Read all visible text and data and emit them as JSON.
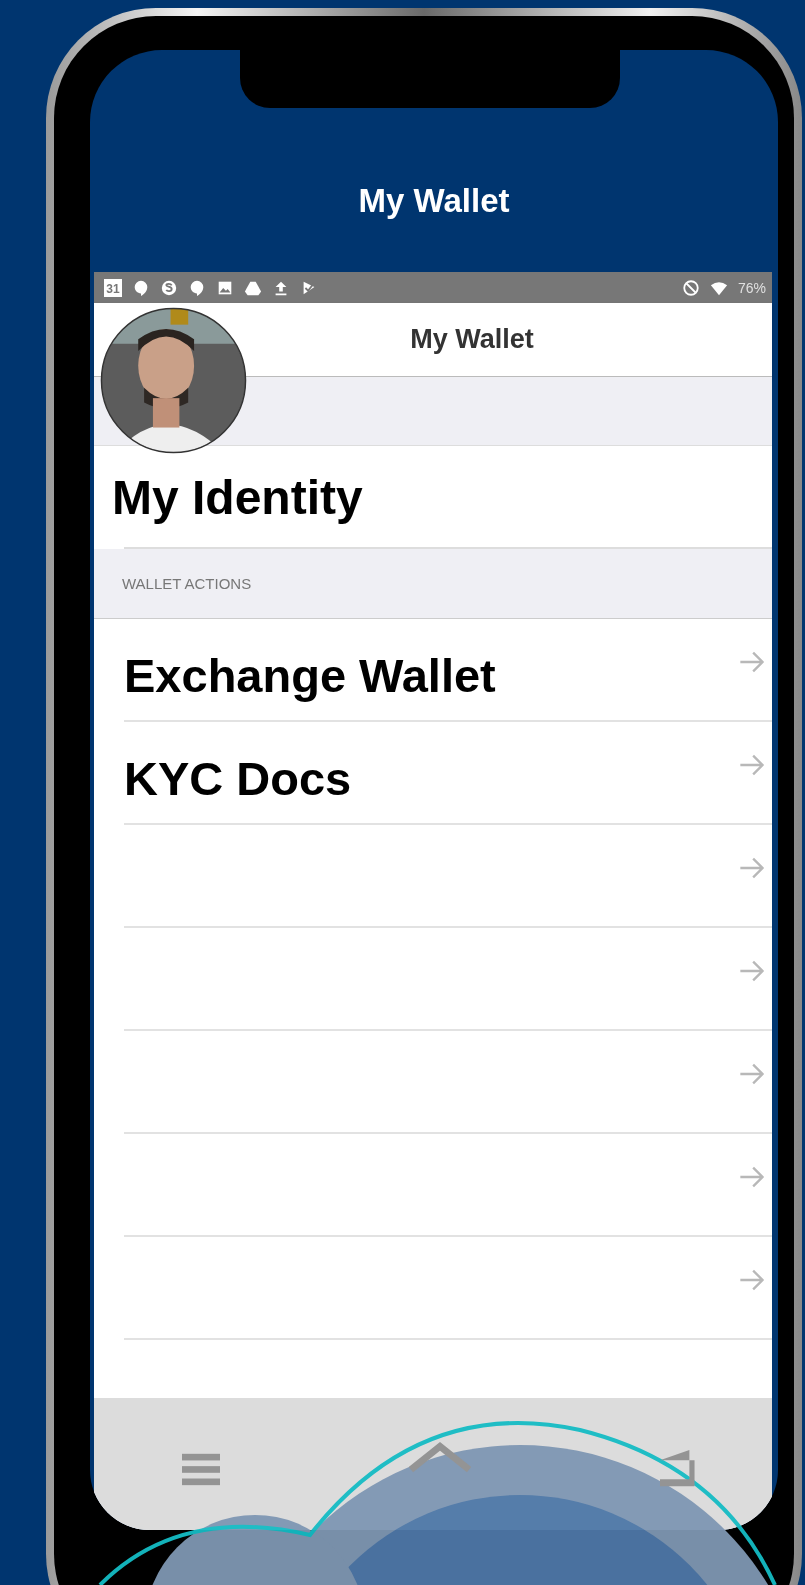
{
  "header": {
    "title": "My Wallet"
  },
  "status_bar": {
    "calendar_date": "31",
    "battery": "76%"
  },
  "app_bar": {
    "title": "My Wallet"
  },
  "identity": {
    "label": "My Identity"
  },
  "section": {
    "title": "WALLET ACTIONS"
  },
  "actions": [
    {
      "kind": "labeled",
      "label": "Exchange Wallet"
    },
    {
      "kind": "labeled",
      "label": "KYC Docs"
    },
    {
      "kind": "blank"
    },
    {
      "kind": "blank"
    },
    {
      "kind": "blank"
    },
    {
      "kind": "blank"
    },
    {
      "kind": "blank"
    }
  ]
}
